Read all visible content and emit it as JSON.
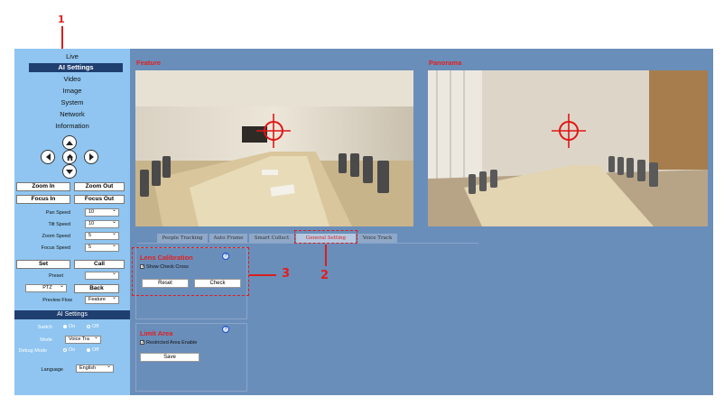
{
  "annotations": {
    "one": "1",
    "two": "2",
    "three": "3"
  },
  "nav": {
    "items": [
      "Live",
      "AI Settings",
      "Video",
      "Image",
      "System",
      "Network",
      "Information"
    ],
    "active_index": 1
  },
  "ptz": {
    "zoom_in": "Zoom In",
    "zoom_out": "Zoom Out",
    "focus_in": "Focus In",
    "focus_out": "Focus Out",
    "speeds": [
      {
        "label": "Pan Speed",
        "value": "10"
      },
      {
        "label": "Tilt Speed",
        "value": "10"
      },
      {
        "label": "Zoom Speed",
        "value": "5"
      },
      {
        "label": "Focus Speed",
        "value": "5"
      }
    ],
    "set": "Set",
    "call": "Call",
    "preset_label": "Preset",
    "preset_value": "",
    "mode_value": "PTZ",
    "back": "Back",
    "preview_flow_label": "Preview Flow",
    "preview_flow_value": "Feature"
  },
  "ai": {
    "title": "AI Settings",
    "switch_label": "Switch",
    "mode_label": "Mode",
    "mode_value": "Voice Tra",
    "debug_label": "Debug Mode",
    "on": "On",
    "off": "Off",
    "language_label": "Language",
    "language_value": "English"
  },
  "main": {
    "feature_title": "Feature",
    "panorama_title": "Panorama",
    "tabs": [
      "People Tracking",
      "Auto Frame",
      "Smart Collect",
      "General Setting",
      "Voice Track"
    ],
    "active_tab": 3,
    "lens": {
      "title": "Lens Calibration",
      "checkbox": "Show Check Cross",
      "reset": "Reset",
      "check": "Check",
      "info": "?"
    },
    "limit": {
      "title": "Limit Area",
      "checkbox": "Restricted Area Enable",
      "save": "Save",
      "info": "?"
    }
  },
  "colors": {
    "accent": "#e02020",
    "sidebar": "#8fc5f0",
    "main": "#6a8eba",
    "nav_active": "#1f3f70"
  }
}
